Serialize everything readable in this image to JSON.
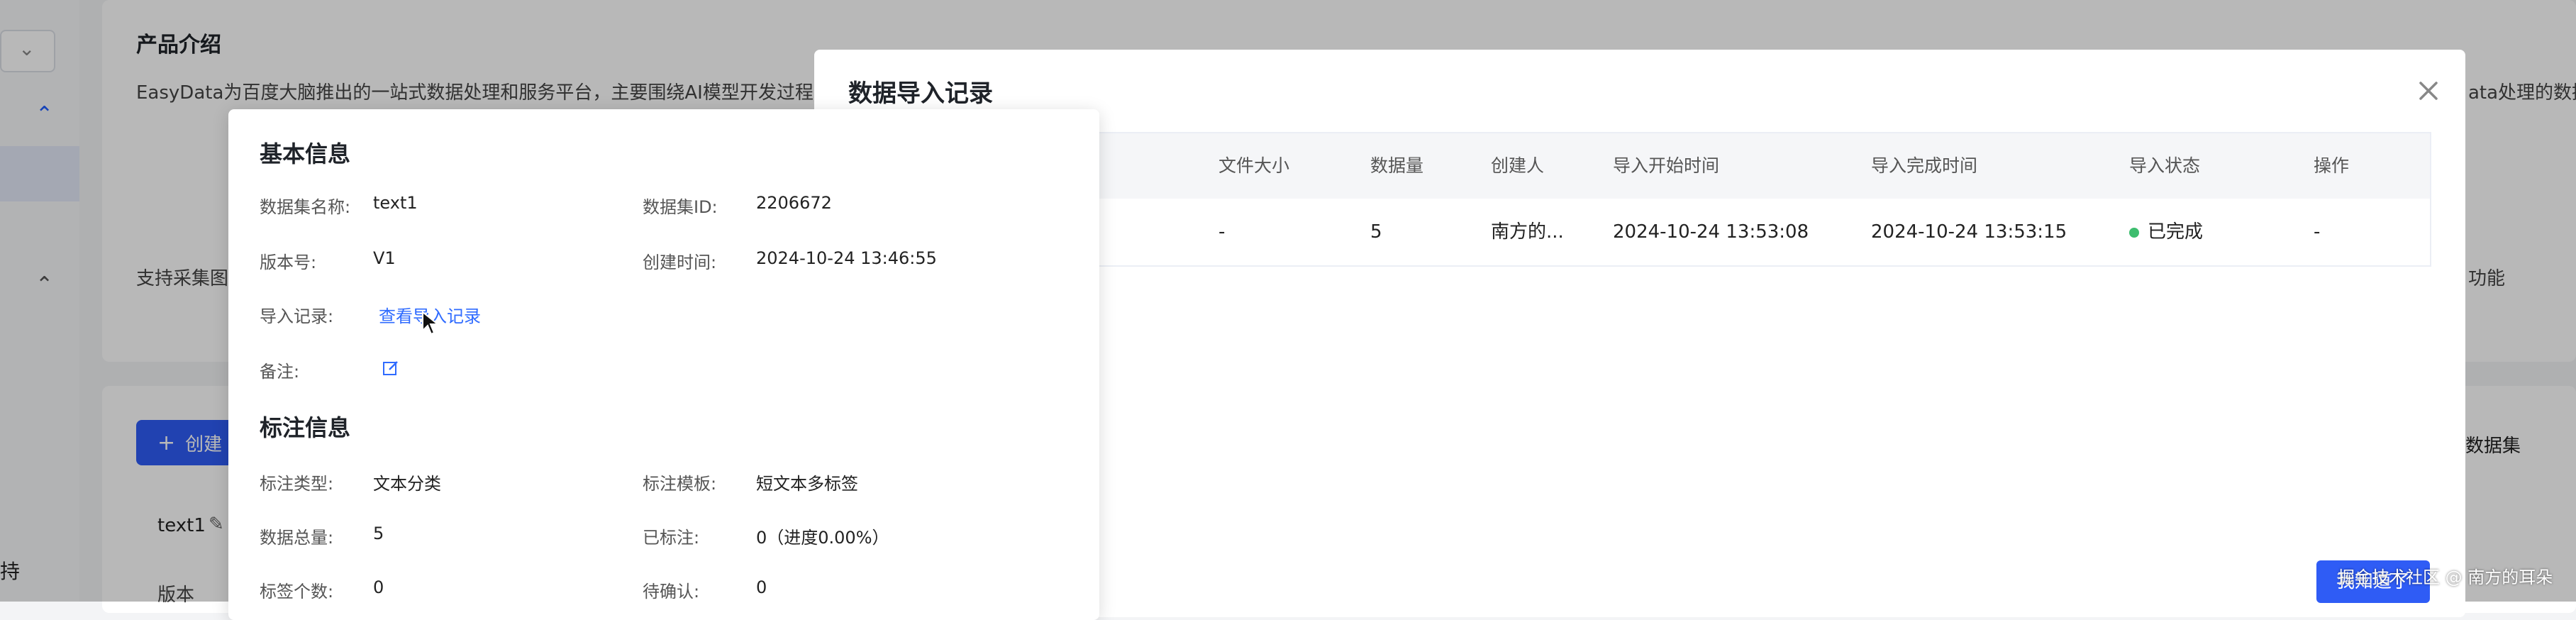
{
  "background": {
    "product_intro_title": "产品介绍",
    "product_intro_desc": "EasyData为百度大脑推出的一站式数据处理和服务平台，主要围绕AI模型开发过程中所需的",
    "right_desc_fragment": "ata处理的数据",
    "support_fragment": "支持采集图片",
    "func_fragment": "功能",
    "create_btn": "创建",
    "dataset_fragment": "数据集",
    "text1_row": "text1",
    "version_col": "版本",
    "left_edge_text": "持"
  },
  "dialog": {
    "title": "数据导入记录",
    "columns": [
      "文件大小",
      "数据量",
      "创建人",
      "导入开始时间",
      "导入完成时间",
      "导入状态",
      "操作"
    ],
    "row": {
      "file_size": "-",
      "count": "5",
      "creator": "南方的...",
      "start_time": "2024-10-24 13:53:08",
      "end_time": "2024-10-24 13:53:15",
      "status": "已完成",
      "action": "-"
    },
    "status_color": "#3dbd6e",
    "confirm_btn": "我知道了"
  },
  "watermark": "掘金技术社区 @ 南方的耳朵",
  "info": {
    "basic_title": "基本信息",
    "dataset_name_label": "数据集名称:",
    "dataset_name_value": "text1",
    "dataset_id_label": "数据集ID:",
    "dataset_id_value": "2206672",
    "version_label": "版本号:",
    "version_value": "V1",
    "created_label": "创建时间:",
    "created_value": "2024-10-24 13:46:55",
    "import_label": "导入记录:",
    "import_link": "查看导入记录",
    "remark_label": "备注:",
    "annot_title": "标注信息",
    "annot_type_label": "标注类型:",
    "annot_type_value": "文本分类",
    "annot_tpl_label": "标注模板:",
    "annot_tpl_value": "短文本多标签",
    "total_label": "数据总量:",
    "total_value": "5",
    "labeled_label": "已标注:",
    "labeled_value": "0（进度0.00%）",
    "tag_count_label": "标签个数:",
    "tag_count_value": "0",
    "pending_label": "待确认:",
    "pending_value": "0"
  }
}
